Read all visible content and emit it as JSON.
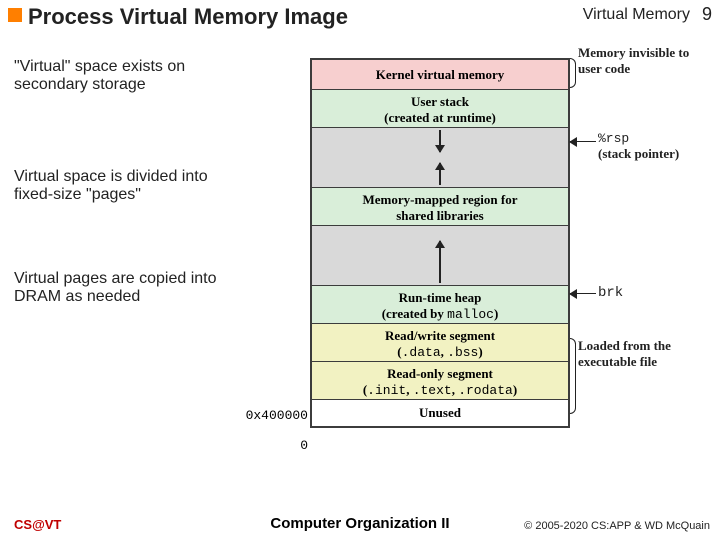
{
  "header": {
    "title": "Process Virtual Memory Image",
    "section": "Virtual Memory",
    "page": "9"
  },
  "notes": {
    "n1": "\"Virtual\" space exists on secondary storage",
    "n2": "Virtual space is divided into fixed-size \"pages\"",
    "n3": "Virtual pages are copied into DRAM as needed"
  },
  "segments": {
    "kernel": "Kernel virtual memory",
    "userstack_l1": "User stack",
    "userstack_l2": "(created at runtime)",
    "mmap_l1": "Memory-mapped region for",
    "mmap_l2": "shared libraries",
    "heap_l1": "Run-time heap",
    "heap_l2_a": "(created by ",
    "heap_l2_b": "malloc",
    "heap_l2_c": ")",
    "rw_l1": "Read/write segment",
    "rw_l2_a": "(",
    "rw_l2_b": ".data",
    "rw_l2_c": ", ",
    "rw_l2_d": ".bss",
    "rw_l2_e": ")",
    "ro_l1": "Read-only segment",
    "ro_l2_a": "(",
    "ro_l2_b": ".init",
    "ro_l2_c": ", ",
    "ro_l2_d": ".text",
    "ro_l2_e": ", ",
    "ro_l2_f": ".rodata",
    "ro_l2_g": ")",
    "unused": "Unused"
  },
  "annotations": {
    "mem_invisible": "Memory invisible to user code",
    "rsp_code": "%rsp",
    "rsp_desc": "(stack pointer)",
    "brk": "brk",
    "loaded": "Loaded from the executable file"
  },
  "addresses": {
    "base": "0x400000",
    "zero": "0"
  },
  "footer": {
    "left_a": "CS",
    "left_b": "@",
    "left_c": "VT",
    "mid": "Computer Organization II",
    "right": "© 2005-2020 CS:APP & WD McQuain"
  }
}
